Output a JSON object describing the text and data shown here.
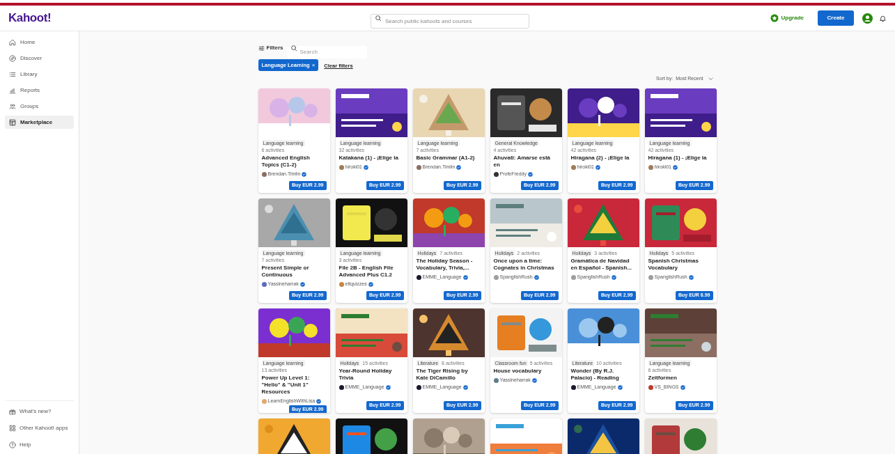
{
  "header": {
    "logo": "Kahoot!",
    "search_placeholder": "Search public kahoots and courses",
    "upgrade": "Upgrade",
    "create": "Create"
  },
  "sidebar": {
    "items": [
      {
        "label": "Home",
        "selected": false
      },
      {
        "label": "Discover",
        "selected": false
      },
      {
        "label": "Library",
        "selected": false
      },
      {
        "label": "Reports",
        "selected": false
      },
      {
        "label": "Groups",
        "selected": false
      },
      {
        "label": "Marketplace",
        "selected": true
      }
    ],
    "bottom_items": [
      {
        "label": "What's new?"
      },
      {
        "label": "Other Kahoot! apps"
      },
      {
        "label": "Help"
      }
    ]
  },
  "filters": {
    "label": "Filters",
    "search_placeholder": "Search",
    "chips": [
      {
        "label": "Language Learning",
        "remove": "×"
      }
    ],
    "clear": "Clear filters",
    "sort_label": "Sort by:",
    "sort_value": "Most Recent"
  },
  "cards": [
    {
      "kind": "full",
      "category": "Language learning",
      "activities": "6 activities",
      "title": "Advanced English Topics (C1-2)",
      "author": "Brendan.Timlin",
      "price": "Buy EUR 2.99"
    },
    {
      "kind": "full",
      "category": "Language learning",
      "activities": "32 activities",
      "title": "Katakana (1) - ¡Elige la",
      "author": "hiroki01",
      "price": "Buy EUR 2.99"
    },
    {
      "kind": "full",
      "category": "Language learning",
      "activities": "7 activities",
      "title": "Basic Grammar (A1-2)",
      "author": "Brendan.Timlin",
      "price": "Buy EUR 2.99"
    },
    {
      "kind": "full",
      "category": "General Knowledge",
      "activities": "4 activities",
      "title": "Ahuvati: Amarse está en",
      "author": "ProfeFreddy",
      "price": "Buy EUR 2.99"
    },
    {
      "kind": "full",
      "category": "Language learning",
      "activities": "42 activities",
      "title": "Hiragana (2) - ¡Elige la",
      "author": "hiroki01",
      "price": "Buy EUR 2.99"
    },
    {
      "kind": "full",
      "category": "Language learning",
      "activities": "42 activities",
      "title": "Hiragana (1) - ¡Elige la",
      "author": "hiroki01",
      "price": "Buy EUR 2.99"
    },
    {
      "kind": "full",
      "category": "Language learning",
      "activities": "7 activities",
      "title": "Present Simple or Continuous",
      "author": "Yassineharrak",
      "price": "Buy EUR 2.99"
    },
    {
      "kind": "full",
      "category": "Language learning",
      "activities": "3 activities",
      "title": "File 2B - English File Advanced Plus C1.2",
      "author": "eltquizzes",
      "price": "Buy EUR 2.99"
    },
    {
      "kind": "full",
      "category": "Holidays",
      "activities": "7 activities",
      "title": "The Holiday Season - Vocabulary, Trivia,...",
      "author": "EMME_Language",
      "price": "Buy EUR 2.99"
    },
    {
      "kind": "full",
      "category": "Holidays",
      "activities": "2 activities",
      "title": "Once upon a time: Cognates in Christmas",
      "author": "SpanglishRush",
      "price": "Buy EUR 2.99"
    },
    {
      "kind": "full",
      "category": "Holidays",
      "activities": "3 activities",
      "title": "Gramática de Navidad en Español - Spanish...",
      "author": "SpanglishRush",
      "price": "Buy EUR 2.99"
    },
    {
      "kind": "full",
      "category": "Holidays",
      "activities": "5 activities",
      "title": "Spanish Christmas Vocabulary",
      "author": "SpanglishRush",
      "price": "Buy EUR 6.99"
    },
    {
      "kind": "full",
      "category": "Language learning",
      "activities": "13 activities",
      "title": "Power Up Level 1: \"Hello\" & \"Unit 1\" Resources",
      "author": "LearnEnglishWithLisa",
      "price": "Buy EUR 2.99"
    },
    {
      "kind": "full",
      "category": "Holidays",
      "activities": "15 activities",
      "title": "Year-Round Holiday Trivia",
      "author": "EMME_Language",
      "price": "Buy EUR 2.99"
    },
    {
      "kind": "full",
      "category": "Literature",
      "activities": "8 activities",
      "title": "The Tiger Rising by Kate DiCamillo",
      "author": "EMME_Language",
      "price": "Buy EUR 2.99"
    },
    {
      "kind": "full",
      "category": "Classroom fun",
      "activities": "5 activities",
      "title": "House vocabulary",
      "author": "Yassineharrak",
      "price": "Buy EUR 2.99"
    },
    {
      "kind": "full",
      "category": "Literature",
      "activities": "10 activities",
      "title": "Wonder (By R.J. Palacio) - Reading",
      "author": "EMME_Language",
      "price": "Buy EUR 2.99"
    },
    {
      "kind": "full",
      "category": "Language learning",
      "activities": "6 activities",
      "title": "Zeitformen",
      "author": "VS_BINGS",
      "price": "Buy EUR 2.99"
    },
    {
      "kind": "image_only"
    },
    {
      "kind": "image_only"
    },
    {
      "kind": "image_only"
    },
    {
      "kind": "image_only"
    },
    {
      "kind": "image_only"
    },
    {
      "kind": "image_only"
    }
  ]
}
